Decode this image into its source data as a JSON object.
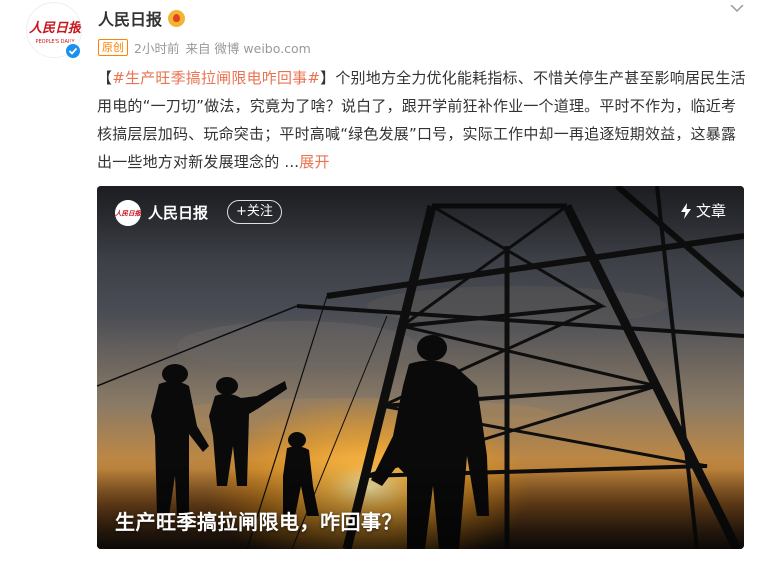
{
  "author": {
    "name": "人民日报",
    "avatar_text": "人民日报",
    "avatar_subtext": "PEOPLE'S DAILY"
  },
  "meta": {
    "original_tag": "原创",
    "time": "2小时前",
    "source": "来自 微博 weibo.com"
  },
  "post": {
    "open_bracket": "【",
    "topic": "#生产旺季搞拉闸限电咋回事#",
    "close_bracket": "】",
    "text": "个别地方全力优化能耗指标、不惜关停生产甚至影响居民生活用电的“一刀切”做法，究竟为了啥？说白了，跟开学前狂补作业一个道理。平时不作为，临近考核搞层层加码、玩命突击；平时高喊“绿色发展”口号，实际工作中却一再追逐短期效益，这暴露出一些地方对新发展理念的 ",
    "ellipsis": "...",
    "expand_label": "展开"
  },
  "card": {
    "author_name": "人民日报",
    "follow_label": "+关注",
    "article_label": "文章",
    "title": "生产旺季搞拉闸限电，咋回事？"
  },
  "colors": {
    "topic": "#eb7350",
    "verified": "#1a91f0",
    "original": "#ff8200"
  }
}
